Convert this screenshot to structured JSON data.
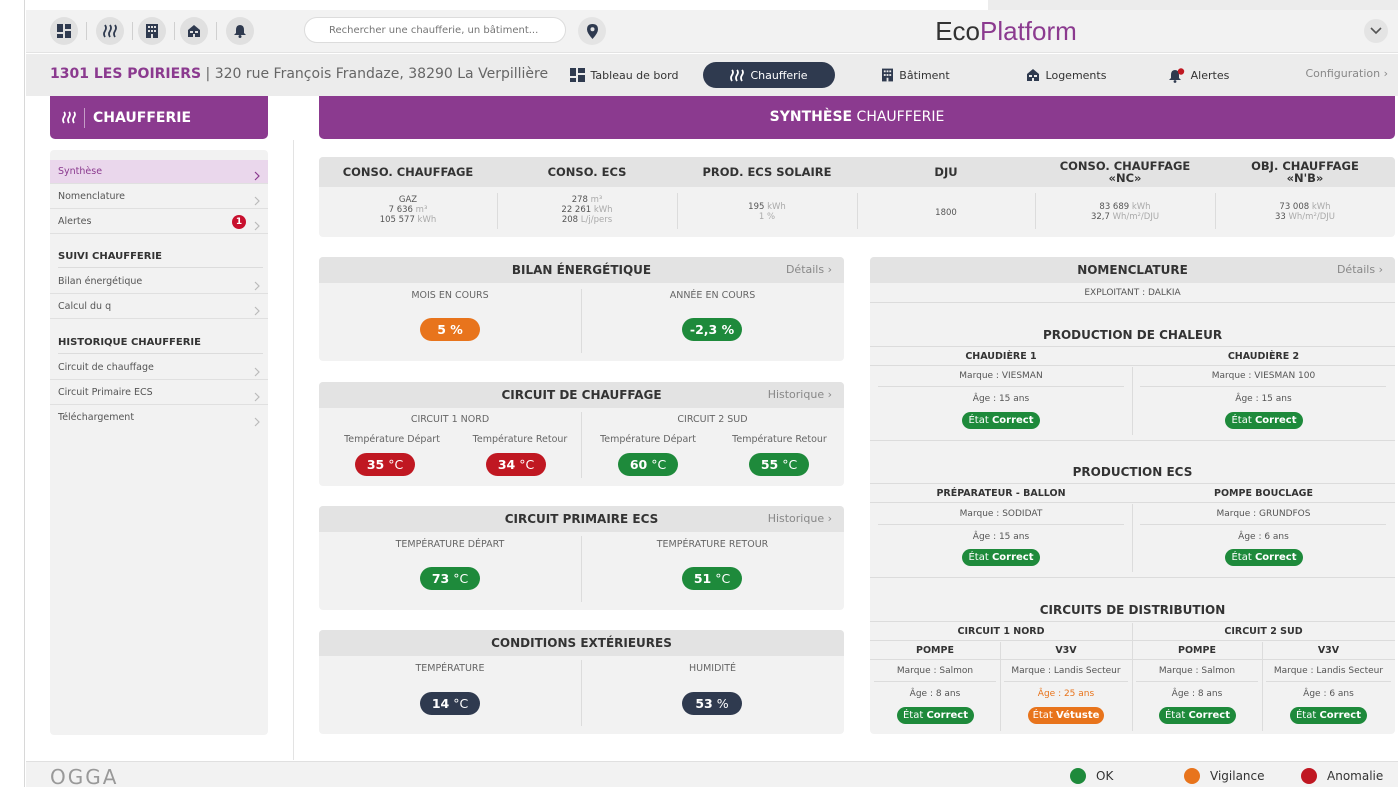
{
  "search": {
    "placeholder": "Rechercher une chaufferie, un bâtiment..."
  },
  "brand": {
    "part1": "Eco",
    "part2": "Platform"
  },
  "navbar": {
    "code": "1301 LES POIRIERS",
    "address": " | 320 rue François Frandaze, 38290 La Verpillière",
    "items": {
      "dashboard": "Tableau de bord",
      "chaufferie": "Chaufferie",
      "batiment": "Bâtiment",
      "logements": "Logements",
      "alertes": "Alertes",
      "config": "Configuration"
    }
  },
  "sidebar": {
    "title": "CHAUFFERIE",
    "items": {
      "synthese": "Synthèse",
      "nomenclature": "Nomenclature",
      "alertes": "Alertes",
      "alert_count": "1",
      "bilan": "Bilan énergétique",
      "calcul": "Calcul du q",
      "circuit_chauffage": "Circuit de chauffage",
      "circuit_ecs": "Circuit Primaire ECS",
      "telechargement": "Téléchargement"
    },
    "sections": {
      "suivi": "SUIVI CHAUFFERIE",
      "historique": "HISTORIQUE CHAUFFERIE"
    }
  },
  "main": {
    "title_bold": "SYNTHÈSE",
    "title_rest": " CHAUFFERIE"
  },
  "summary": {
    "chauffage": {
      "header": "CONSO. CHAUFFAGE",
      "fuel": "GAZ",
      "v1": "7 636",
      "u1": " m³",
      "v2": "105 577",
      "u2": " kWh"
    },
    "ecs": {
      "header": "CONSO. ECS",
      "v1": "278",
      "u1": " m³",
      "v2": "22 261",
      "u2": " kWh",
      "v3": "208",
      "u3": " L/j/pers"
    },
    "solaire": {
      "header": "PROD. ECS SOLAIRE",
      "v1": "195",
      "u1": " kWh",
      "v2": "1 %"
    },
    "dju": {
      "header": "DJU",
      "v1": "1800"
    },
    "nc": {
      "header1": "CONSO. CHAUFFAGE",
      "header2": "«NC»",
      "v1": "83 689",
      "u1": " kWh",
      "v2": "32,7",
      "u2": " Wh/m²/DJU"
    },
    "obj": {
      "header1": "OBJ. CHAUFFAGE",
      "header2": "«N'B»",
      "v1": "73 008",
      "u1": " kWh",
      "v2": "33",
      "u2": " Wh/m²/DJU"
    }
  },
  "bilan": {
    "title": "BILAN ÉNERGÉTIQUE",
    "link": "Détails",
    "mois_label": "MOIS EN COURS",
    "mois_value": "5 %",
    "annee_label": "ANNÉE EN COURS",
    "annee_value": "-2,3 %"
  },
  "circuit": {
    "title": "CIRCUIT DE CHAUFFAGE",
    "link": "Historique",
    "c1_name": "CIRCUIT 1 NORD",
    "c2_name": "CIRCUIT 2 SUD",
    "depart_label": "Température Départ",
    "retour_label": "Température Retour",
    "unit": " °C",
    "c1_depart": "35",
    "c1_retour": "34",
    "c2_depart": "60",
    "c2_retour": "55"
  },
  "ecs_circuit": {
    "title": "CIRCUIT PRIMAIRE ECS",
    "link": "Historique",
    "depart_label": "TEMPÉRATURE DÉPART",
    "retour_label": "TEMPÉRATURE RETOUR",
    "unit": " °C",
    "depart": "73",
    "retour": "51"
  },
  "ext": {
    "title": "CONDITIONS EXTÉRIEURES",
    "temp_label": "TEMPÉRATURE",
    "hum_label": "HUMIDITÉ",
    "temp": "14",
    "temp_unit": " °C",
    "hum": "53",
    "hum_unit": " %"
  },
  "nom": {
    "title": "NOMENCLATURE",
    "link": "Détails",
    "exploitant": "EXPLOITANT : DALKIA",
    "etat_prefix": "État ",
    "prod_chaleur": {
      "title": "PRODUCTION DE CHALEUR",
      "c1": {
        "name": "CHAUDIÈRE 1",
        "marque": "Marque : VIESMAN",
        "age": "Âge : 15 ans",
        "etat": "Correct"
      },
      "c2": {
        "name": "CHAUDIÈRE 2",
        "marque": "Marque : VIESMAN 100",
        "age": "Âge : 15 ans",
        "etat": "Correct"
      }
    },
    "prod_ecs": {
      "title": "PRODUCTION ECS",
      "c1": {
        "name": "PRÉPARATEUR - BALLON",
        "marque": "Marque : SODIDAT",
        "age": "Âge : 15 ans",
        "etat": "Correct"
      },
      "c2": {
        "name": "POMPE BOUCLAGE",
        "marque": "Marque : GRUNDFOS",
        "age": "Âge : 6 ans",
        "etat": "Correct"
      }
    },
    "distrib": {
      "title": "CIRCUITS DE DISTRIBUTION",
      "n1": "CIRCUIT 1 NORD",
      "n2": "CIRCUIT 2 SUD",
      "pompe": "POMPE",
      "v3v": "V3V",
      "c1p": {
        "marque": "Marque : Salmon",
        "age": "Âge : 8 ans",
        "etat": "Correct"
      },
      "c1v": {
        "marque": "Marque : Landis Secteur",
        "age": "Âge : 25 ans",
        "etat": "Vétuste"
      },
      "c2p": {
        "marque": "Marque : Salmon",
        "age": "Âge : 8 ans",
        "etat": "Correct"
      },
      "c2v": {
        "marque": "Marque : Landis Secteur",
        "age": "Âge : 6 ans",
        "etat": "Correct"
      }
    }
  },
  "footer": {
    "logo": "OGGA",
    "ok": "OK",
    "vigilance": "Vigilance",
    "anomalie": "Anomalie"
  },
  "colors": {
    "brand": "#8b3a8f",
    "ok": "#1e8a3b",
    "vigilance": "#e8741c",
    "anomalie": "#c01822",
    "navy": "#2f3a4f"
  }
}
